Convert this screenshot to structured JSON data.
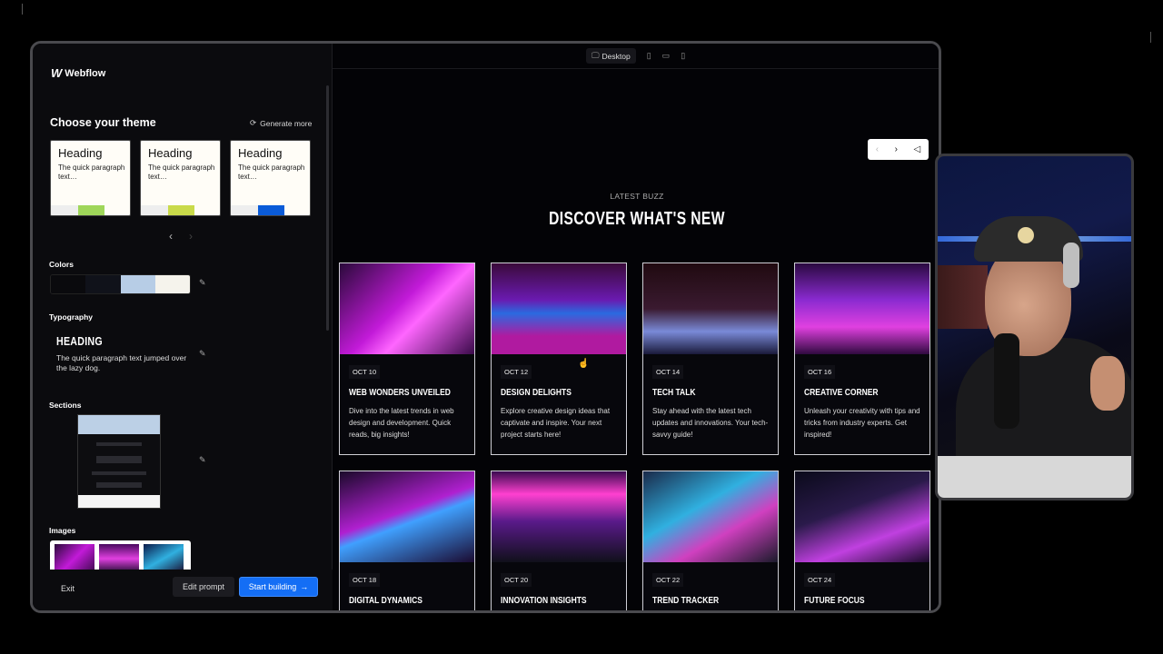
{
  "app": {
    "name": "Webflow",
    "logo_mark": "W"
  },
  "sidebar": {
    "theme_title": "Choose your theme",
    "generate_more": "Generate more",
    "theme_cards": [
      {
        "heading": "Heading",
        "paragraph": "The quick paragraph text…",
        "swatch": "#9fd65a"
      },
      {
        "heading": "Heading",
        "paragraph": "The quick paragraph text…",
        "swatch": "#c9da4a"
      },
      {
        "heading": "Heading",
        "paragraph": "The quick paragraph text…",
        "swatch": "#0a5bd8"
      }
    ],
    "prev_arrow": "‹",
    "next_arrow": "›",
    "colors_label": "Colors",
    "colors": [
      "#0a0a0d",
      "#10121a",
      "#b7cde6",
      "#f5f3ec"
    ],
    "typography_label": "Typography",
    "typography_heading": "HEADING",
    "typography_paragraph": "The quick paragraph text jumped over the lazy dog.",
    "sections_label": "Sections",
    "images_label": "Images",
    "exit": "Exit",
    "edit_prompt": "Edit prompt",
    "start_building": "Start building",
    "start_arrow": "→",
    "pencil": "✎"
  },
  "preview": {
    "device_desktop": "Desktop",
    "slider_prev": "‹",
    "slider_next": "›",
    "slider_icon": "◁",
    "kicker": "LATEST BUZZ",
    "headline": "DISCOVER WHAT'S NEW",
    "cards": [
      {
        "date": "OCT 10",
        "title": "WEB WONDERS UNVEILED",
        "desc": "Dive into the latest trends in web design and development. Quick reads, big insights!",
        "img": "linear-gradient(135deg,#2a0a3a,#c21ad8 45%,#ff66ff 60%,#3a0a4a)"
      },
      {
        "date": "OCT 12",
        "title": "DESIGN DELIGHTS",
        "desc": "Explore creative design ideas that captivate and inspire. Your next project starts here!",
        "img": "linear-gradient(180deg,#3a0a3a,#6a1ab0 40%,#2a6ae0 55%,#b01aa0 80%)"
      },
      {
        "date": "OCT 14",
        "title": "TECH TALK",
        "desc": "Stay ahead with the latest tech updates and innovations. Your tech-savvy guide!",
        "img": "linear-gradient(180deg,#200a10,#3a1a30 50%,#7a8ad8 75%,#1a1a3a)"
      },
      {
        "date": "OCT 16",
        "title": "CREATIVE CORNER",
        "desc": "Unleash your creativity with tips and tricks from industry experts. Get inspired!",
        "img": "linear-gradient(180deg,#2a0a40,#8a2ad0 40%,#e040e0 70%,#300a40)"
      },
      {
        "date": "OCT 18",
        "title": "DIGITAL DYNAMICS",
        "desc": "",
        "img": "linear-gradient(160deg,#1a0a2a,#b020d0 45%,#40a0ff 55%,#1a0a30)"
      },
      {
        "date": "OCT 20",
        "title": "INNOVATION INSIGHTS",
        "desc": "",
        "img": "linear-gradient(180deg,#3a0a50,#ff40d0 25%,#5a1a8a 55%,#10101a)"
      },
      {
        "date": "OCT 22",
        "title": "TREND TRACKER",
        "desc": "",
        "img": "linear-gradient(150deg,#1a2a4a,#30b0e0 40%,#d040c0 65%,#1a1a2a)"
      },
      {
        "date": "OCT 24",
        "title": "FUTURE FOCUS",
        "desc": "",
        "img": "linear-gradient(160deg,#0a0a1a,#2a1a4a 40%,#c040e0 70%,#1a0a2a)"
      }
    ]
  }
}
